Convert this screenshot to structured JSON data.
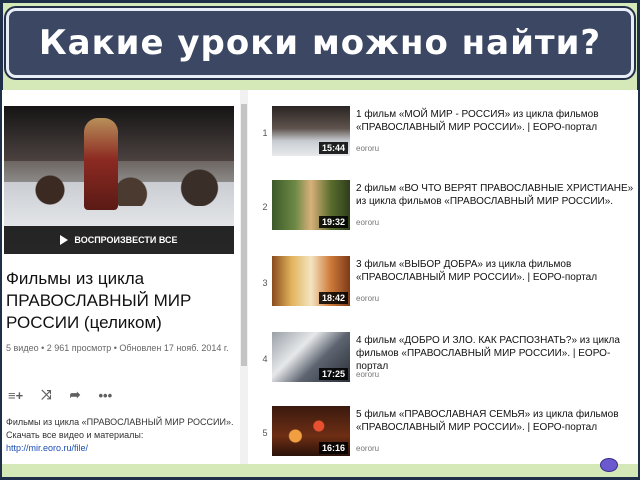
{
  "slide": {
    "title": "Какие уроки можно найти?"
  },
  "playlist": {
    "play_all_label": "ВОСПРОИЗВЕСТИ ВСЕ",
    "title": "Фильмы из цикла ПРАВОСЛАВНЫЙ МИР РОССИИ (целиком)",
    "meta": "5 видео • 2 961 просмотр • Обновлен 17 нояб. 2014 г.",
    "actions": [
      "≡+",
      "⤨",
      "➦",
      "•••"
    ],
    "description": "Фильмы из цикла «ПРАВОСЛАВНЫЙ МИР РОССИИ». Скачать все видео и материалы:",
    "link": "http://mir.eoro.ru/file/"
  },
  "videos": [
    {
      "index": "1",
      "duration": "15:44",
      "title": "1 фильм «МОЙ МИР - РОССИЯ» из цикла фильмов «ПРАВОСЛАВНЫЙ МИР РОССИИ». | ЕОРО-портал",
      "channel": "eororu"
    },
    {
      "index": "2",
      "duration": "19:32",
      "title": "2 фильм «ВО ЧТО ВЕРЯТ ПРАВОСЛАВНЫЕ ХРИСТИАНЕ» из цикла фильмов «ПРАВОСЛАВНЫЙ МИР РОССИИ».",
      "channel": "eororu"
    },
    {
      "index": "3",
      "duration": "18:42",
      "title": "3 фильм «ВЫБОР ДОБРА» из цикла фильмов «ПРАВОСЛАВНЫЙ МИР РОССИИ». | ЕОРО-портал",
      "channel": "eororu"
    },
    {
      "index": "4",
      "duration": "17:25",
      "title": "4 фильм «ДОБРО И ЗЛО. КАК РАСПОЗНАТЬ?» из цикла фильмов «ПРАВОСЛАВНЫЙ МИР РОССИИ». | ЕОРО-портал",
      "channel": "eororu"
    },
    {
      "index": "5",
      "duration": "16:16",
      "title": "5 фильм «ПРАВОСЛАВНАЯ СЕМЬЯ» из цикла фильмов «ПРАВОСЛАВНЫЙ МИР РОССИИ». | ЕОРО-портал",
      "channel": "eororu"
    }
  ],
  "colors": {
    "banner_bg": "#3b4763",
    "slide_bg": "#d5e8b8",
    "frame_border": "#1f2f4a"
  }
}
